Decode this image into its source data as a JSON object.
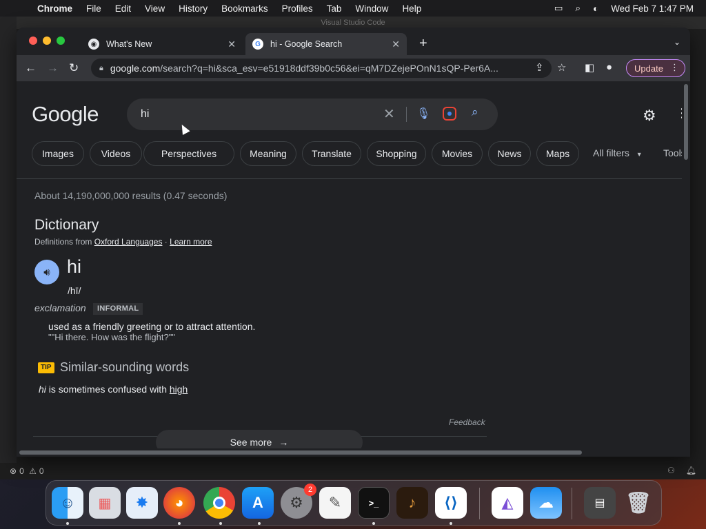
{
  "menubar": {
    "app": "Chrome",
    "items": [
      "File",
      "Edit",
      "View",
      "History",
      "Bookmarks",
      "Profiles",
      "Tab",
      "Window",
      "Help"
    ],
    "clock": "Wed Feb 7  1:47 PM"
  },
  "vscode": {
    "title": "Visual Studio Code",
    "errors": "0",
    "warnings": "0"
  },
  "tabs": [
    {
      "title": "What's New",
      "active": false
    },
    {
      "title": "hi - Google Search",
      "active": true
    }
  ],
  "omnibox": {
    "host": "google.com",
    "path": "/search?q=hi&sca_esv=e51918ddf39b0c56&ei=qM7DZejePOnN1sQP-Per6A..."
  },
  "update_label": "Update",
  "search": {
    "logo": "Google",
    "query": "hi"
  },
  "chips": [
    "Images",
    "Videos",
    "Perspectives",
    "Meaning",
    "Translate",
    "Shopping",
    "Movies",
    "News",
    "Maps"
  ],
  "all_filters": "All filters",
  "tools": "Tools",
  "results_stats": "About 14,190,000,000 results (0.47 seconds)",
  "dictionary": {
    "heading": "Dictionary",
    "source_prefix": "Definitions from ",
    "source_link": "Oxford Languages",
    "learn_more": "Learn more",
    "word": "hi",
    "phonetic": "/hī/",
    "part_of_speech": "exclamation",
    "register": "INFORMAL",
    "definition": "used as a friendly greeting or to attract attention.",
    "example": "\"\"Hi there. How was the flight?\"\"",
    "tip_label": "TIP",
    "similar_heading": "Similar-sounding words",
    "confused_word": "hi",
    "confused_text": " is sometimes confused with ",
    "confused_link": "high",
    "feedback": "Feedback",
    "see_more": "See more"
  },
  "dock": {
    "apps": [
      "Finder",
      "Launchpad",
      "Safari",
      "Firefox",
      "Chrome",
      "App Store",
      "System Settings",
      "TextEdit",
      "Terminal",
      "GarageBand",
      "Visual Studio Code",
      "Visual Studio",
      "Weather",
      "Downloads",
      "Trash"
    ],
    "settings_badge": "2"
  }
}
